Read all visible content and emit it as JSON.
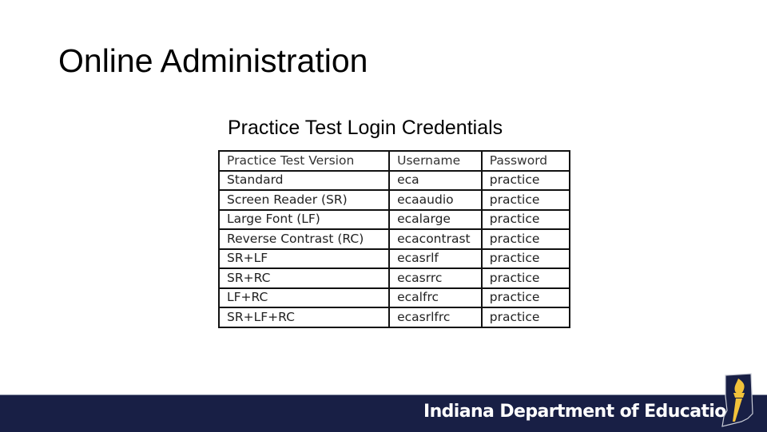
{
  "slide": {
    "title": "Online Administration",
    "caption": "Practice Test Login Credentials"
  },
  "table": {
    "headers": [
      "Practice Test Version",
      "Username",
      "Password"
    ],
    "rows": [
      [
        "Standard",
        "eca",
        "practice"
      ],
      [
        "Screen Reader (SR)",
        "ecaaudio",
        "practice"
      ],
      [
        "Large Font (LF)",
        "ecalarge",
        "practice"
      ],
      [
        "Reverse Contrast (RC)",
        "ecacontrast",
        "practice"
      ],
      [
        "SR+LF",
        "ecasrlf",
        "practice"
      ],
      [
        "SR+RC",
        "ecasrrc",
        "practice"
      ],
      [
        "LF+RC",
        "ecalfrc",
        "practice"
      ],
      [
        "SR+LF+RC",
        "ecasrlfrc",
        "practice"
      ]
    ]
  },
  "footer": {
    "organization": "Indiana Department of Education",
    "logo_icon": "indiana-torch-icon",
    "bar_color": "#181f45",
    "logo_gold": "#f2c23a"
  }
}
